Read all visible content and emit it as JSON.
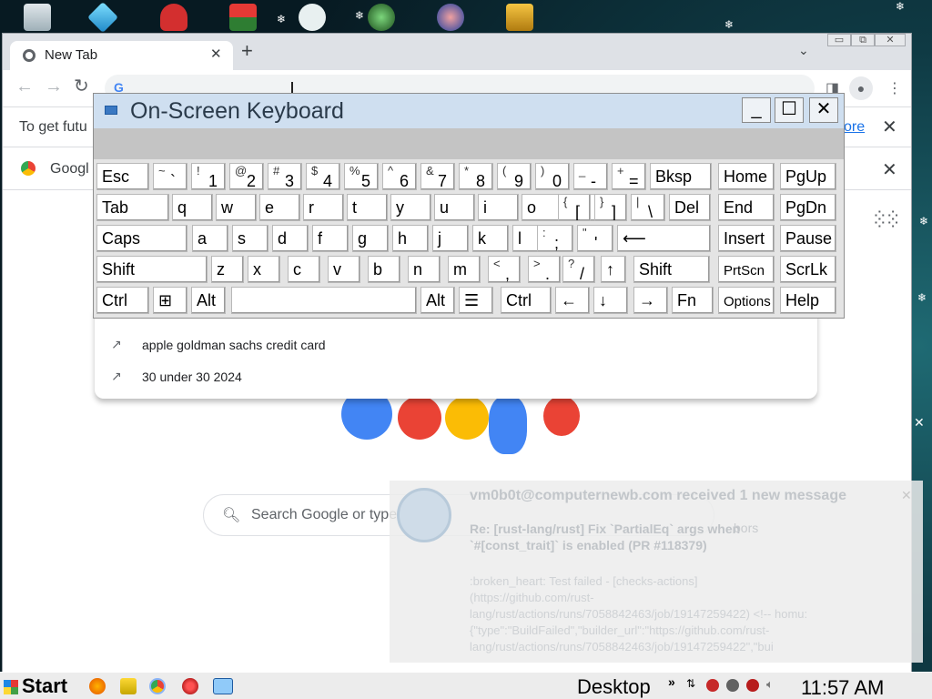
{
  "browser": {
    "tab_title": "New Tab",
    "tab_close": "✕",
    "new_tab": "+",
    "tab_search": "⌄",
    "win_min": "▭",
    "win_max": "⧉",
    "win_close": "✕",
    "omnibox_value": "",
    "infobar_text": "To get futu",
    "infobar_link": "ore",
    "infobar_close": "✕",
    "bookmark_text": "Googl",
    "bookmark_close": "✕"
  },
  "suggestions": [
    {
      "icon": "trending-icon",
      "text": "apple goldman sachs credit card"
    },
    {
      "icon": "trending-icon",
      "text": "30 under 30 2024"
    }
  ],
  "searchbox": {
    "placeholder": "Search Google or type a URL"
  },
  "osk": {
    "title": "On-Screen Keyboard",
    "rows": [
      [
        {
          "label": "Esc"
        },
        {
          "shift": "~",
          "main": "`"
        },
        {
          "shift": "!",
          "main": "1"
        },
        {
          "shift": "@",
          "main": "2"
        },
        {
          "shift": "#",
          "main": "3"
        },
        {
          "shift": "$",
          "main": "4"
        },
        {
          "shift": "%",
          "main": "5"
        },
        {
          "shift": "^",
          "main": "6"
        },
        {
          "shift": "&",
          "main": "7"
        },
        {
          "shift": "*",
          "main": "8"
        },
        {
          "shift": "(",
          "main": "9"
        },
        {
          "shift": ")",
          "main": "0"
        },
        {
          "shift": "_",
          "main": "-"
        },
        {
          "shift": "+",
          "main": "="
        },
        {
          "label": "Bksp"
        },
        {
          "label": "Home"
        },
        {
          "label": "PgUp"
        }
      ],
      [
        {
          "label": "Tab"
        },
        {
          "label": "q"
        },
        {
          "label": "w"
        },
        {
          "label": "e"
        },
        {
          "label": "r"
        },
        {
          "label": "t"
        },
        {
          "label": "y"
        },
        {
          "label": "u"
        },
        {
          "label": "i"
        },
        {
          "label": "o"
        },
        {
          "label": "p"
        },
        {
          "shift": "{",
          "main": "["
        },
        {
          "shift": "}",
          "main": "]"
        },
        {
          "shift": "|",
          "main": "\\"
        },
        {
          "label": "Del"
        },
        {
          "label": "End"
        },
        {
          "label": "PgDn"
        }
      ],
      [
        {
          "label": "Caps"
        },
        {
          "label": "a"
        },
        {
          "label": "s"
        },
        {
          "label": "d"
        },
        {
          "label": "f"
        },
        {
          "label": "g"
        },
        {
          "label": "h"
        },
        {
          "label": "j"
        },
        {
          "label": "k"
        },
        {
          "label": "l"
        },
        {
          "shift": ":",
          "main": ";"
        },
        {
          "shift": "\"",
          "main": "'"
        },
        {
          "label": "⟵"
        },
        {
          "label": "Insert"
        },
        {
          "label": "Pause"
        }
      ],
      [
        {
          "label": "Shift"
        },
        {
          "label": "z"
        },
        {
          "label": "x"
        },
        {
          "label": "c"
        },
        {
          "label": "v"
        },
        {
          "label": "b"
        },
        {
          "label": "n"
        },
        {
          "label": "m"
        },
        {
          "shift": "<",
          "main": ","
        },
        {
          "shift": ">",
          "main": "."
        },
        {
          "shift": "?",
          "main": "/"
        },
        {
          "label": "↑"
        },
        {
          "label": "Shift"
        },
        {
          "label": "PrtScn"
        },
        {
          "label": "ScrLk"
        }
      ],
      [
        {
          "label": "Ctrl"
        },
        {
          "label": "⊞"
        },
        {
          "label": "Alt"
        },
        {
          "label": ""
        },
        {
          "label": "Alt"
        },
        {
          "label": "☰"
        },
        {
          "label": "Ctrl"
        },
        {
          "label": "←"
        },
        {
          "label": "↓"
        },
        {
          "label": "→"
        },
        {
          "label": "Fn"
        },
        {
          "label": "Options"
        },
        {
          "label": "Help"
        }
      ]
    ]
  },
  "notification": {
    "title": "vm0b0t@computernewb.com received 1 new message",
    "close": "✕",
    "subject": "Re: [rust-lang/rust] Fix `PartialEq` args when `#[const_trait]` is enabled (PR #118379)",
    "sender": "bors",
    "body": ":broken_heart: Test failed - [checks-actions]\n(https://github.com/rust-lang/rust/actions/runs/7058842463/job/19147259422) <!-- homu:\n{\"type\":\"BuildFailed\",\"builder_url\":\"https://github.com/rust-lang/rust/actions/runs/7058842463/job/19147259422\",\"bui"
  },
  "taskbar": {
    "start": "Start",
    "desktop": "Desktop",
    "chevron": "»",
    "clock": "11:57 AM"
  },
  "colors": {
    "osk_title_bg": "#cfdff0",
    "link": "#1a73e8",
    "taskbar": "#ececec"
  }
}
